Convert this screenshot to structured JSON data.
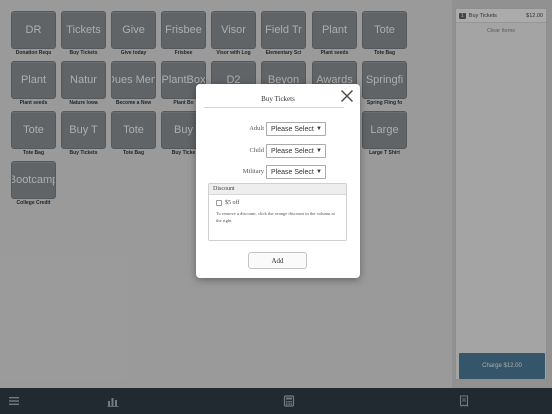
{
  "tiles": [
    {
      "label": "DR",
      "caption": "Donation Requ"
    },
    {
      "label": "Tickets",
      "caption": "Buy Tickets"
    },
    {
      "label": "Give",
      "caption": "Give today"
    },
    {
      "label": "Frisbee",
      "caption": "Frisbee"
    },
    {
      "label": "Visor",
      "caption": "Visor with Log"
    },
    {
      "label": "Field Tr",
      "caption": "Elementary Sci"
    },
    {
      "label": "Plant",
      "caption": "Plant seeds"
    },
    {
      "label": "Tote",
      "caption": "Tote Bag"
    },
    {
      "label": "Plant",
      "caption": "Plant seeds"
    },
    {
      "label": "Natur",
      "caption": "Nature Iowa"
    },
    {
      "label": "Dues Mem",
      "caption": "Become a New"
    },
    {
      "label": "PlantBox",
      "caption": "Plant Bo"
    },
    {
      "label": "D2",
      "caption": ""
    },
    {
      "label": "Beyon",
      "caption": ""
    },
    {
      "label": "Awards",
      "caption": ""
    },
    {
      "label": "Springfi",
      "caption": "Spring Fling fo"
    },
    {
      "label": "Tote",
      "caption": "Tote Bag"
    },
    {
      "label": "Buy T",
      "caption": "Buy Tickets"
    },
    {
      "label": "Tote",
      "caption": "Tote Bag"
    },
    {
      "label": "Buy",
      "caption": "Buy Ticke"
    },
    {
      "label": "",
      "caption": ""
    },
    {
      "label": "",
      "caption": ""
    },
    {
      "label": "",
      "caption": ""
    },
    {
      "label": "Large",
      "caption": "Large T Shirt"
    },
    {
      "label": "Bootcamp",
      "caption": "College Credit"
    }
  ],
  "cart": {
    "items": [
      {
        "qty": "1",
        "name": "Buy Tickets",
        "price": "$12.00"
      }
    ],
    "clear_label": "Clear Items",
    "charge_label": "Charge $12.00"
  },
  "bottom_bar": {
    "icons": [
      "menu-icon",
      "chart-icon",
      "calculator-icon",
      "receipt-icon"
    ]
  },
  "modal": {
    "title": "Buy Tickets",
    "fields": [
      {
        "label": "Adult",
        "value": "Please Select"
      },
      {
        "label": "Child",
        "value": "Please Select"
      },
      {
        "label": "Military",
        "value": "Please Select"
      }
    ],
    "discount": {
      "heading": "Discount",
      "option": "$5 off",
      "note": "To remove a discount, click the orange discount in the column at the right."
    },
    "add_label": "Add"
  },
  "colors": {
    "tile": "#7e8489",
    "charge": "#3d6f8e",
    "bottom_bar": "#1e2a36"
  }
}
